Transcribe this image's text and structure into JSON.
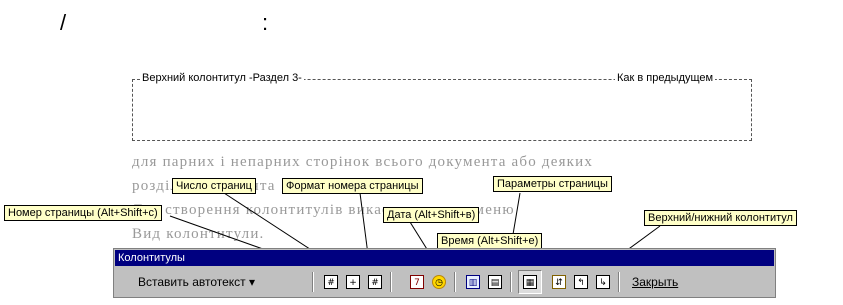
{
  "caption": {
    "part1": "/",
    "part2": ":"
  },
  "header": {
    "left_label": "Верхний колонтитул -Раздел 3-",
    "right_label": "Как в предыдущем"
  },
  "document": {
    "lines": [
      "для парних і непарних сторінок всього документа або деяких",
      "розділів документа",
      "Для створення колонтитулів викається пункт меню",
      "Вид колонтитули."
    ]
  },
  "callouts": {
    "page_number": "Номер страницы (Alt+Shift+c)",
    "page_count": "Число страниц",
    "page_format": "Формат номера страницы",
    "date": "Дата (Alt+Shift+в)",
    "time": "Время (Alt+Shift+е)",
    "page_setup": "Параметры страницы",
    "switch_header_footer": "Верхний/нижний колонтитул"
  },
  "toolbar": {
    "title": "Колонтитулы",
    "autotext_label": "Вставить автотекст ▾",
    "close_label": "Закрыть",
    "icons": {
      "page_number": "#",
      "page_count": "+",
      "page_format": "#",
      "date": "7",
      "time": "◷",
      "page_setup": "▥",
      "same_as_previous": "▤",
      "show_text": "▦",
      "switch": "⇵",
      "prev": "↰",
      "next": "↳"
    }
  },
  "colors": {
    "callout_bg": "#ffffc8",
    "titlebar": "#000080",
    "toolbar_bg": "#c0c0c0"
  }
}
